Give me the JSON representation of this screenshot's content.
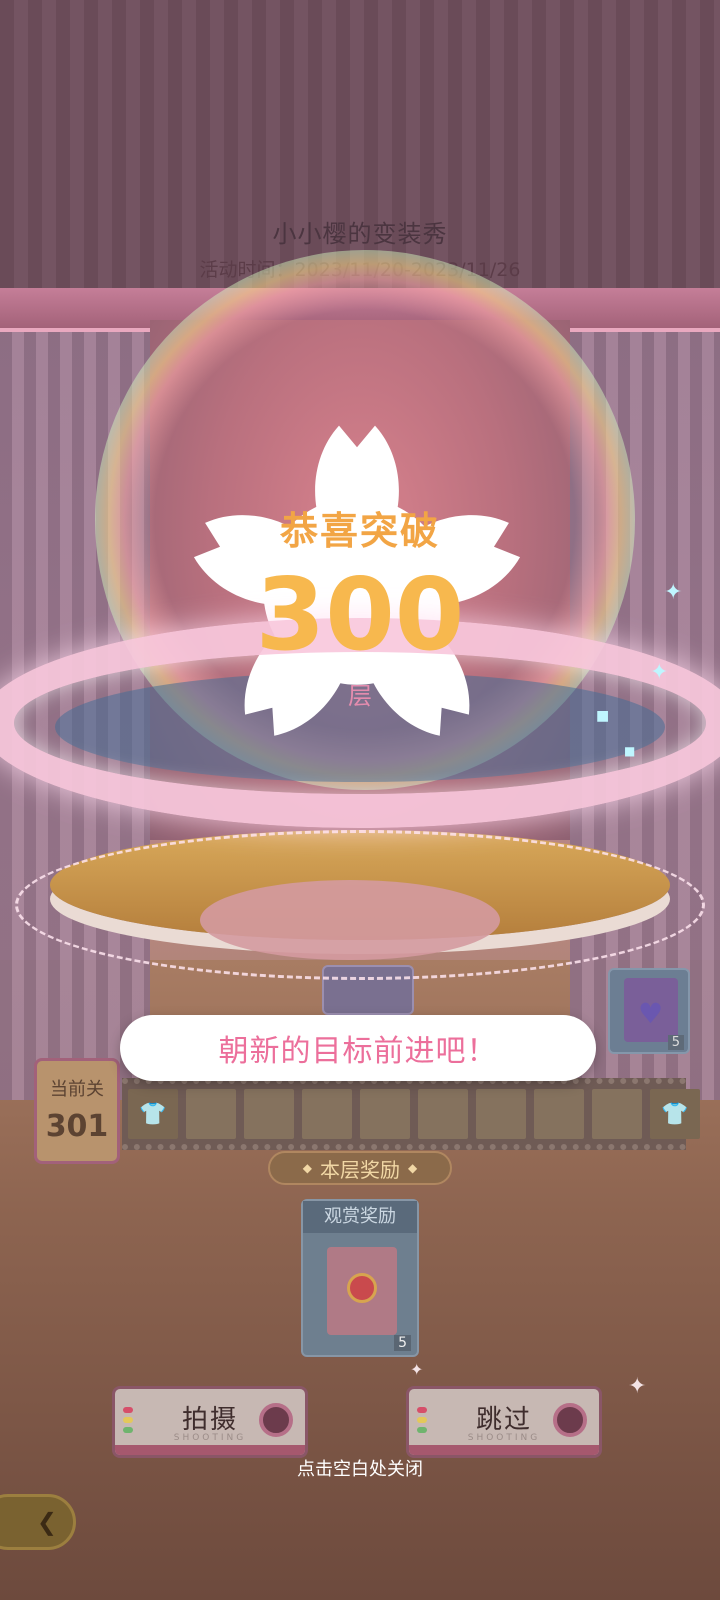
{
  "event": {
    "title": "小小樱的变装秀",
    "time": "活动时间：2023/11/20-2023/11/26"
  },
  "popup": {
    "congrats": "恭喜突破",
    "floor_number": "300",
    "floor_unit": "层",
    "message": "朝新的目标前进吧！",
    "close_hint": "点击空白处关闭"
  },
  "progress": {
    "current_label": "当前关",
    "current_level": "301",
    "reward_badge_count": "5"
  },
  "reward": {
    "section_title": "本层奖励",
    "card_label": "观赏奖励",
    "count": "5"
  },
  "buttons": {
    "shoot": "拍摄",
    "skip": "跳过",
    "sub_caption": "SHOOTING"
  },
  "colors": {
    "accent_pink": "#ec6f9b",
    "gold": "#f7b84e"
  },
  "icons": {
    "back": "back-arrow-icon",
    "camera": "camera-lens-icon",
    "sparkle": "sparkle-icon"
  }
}
